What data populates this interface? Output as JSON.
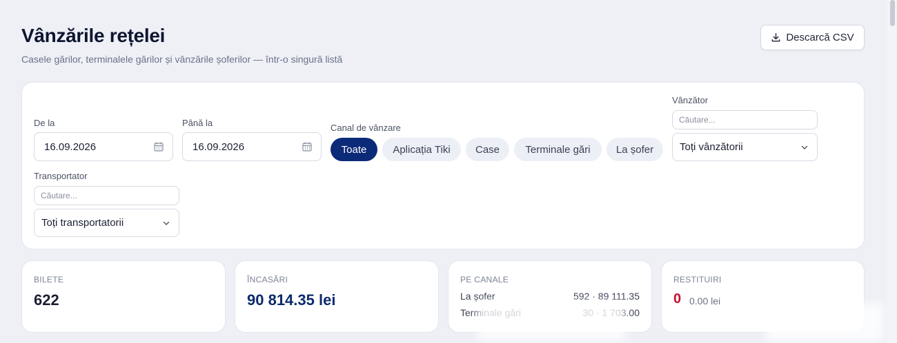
{
  "header": {
    "title": "Vânzările rețelei",
    "subtitle": "Casele gărilor, terminalele gărilor și vânzările șoferilor — într-o singură listă",
    "csv_button": "Descarcă CSV",
    "csv_icon": "download-icon"
  },
  "filters": {
    "date_from": {
      "label": "De la",
      "value": "16.09.2026",
      "icon": "calendar-icon"
    },
    "date_to": {
      "label": "Până la",
      "value": "16.09.2026",
      "icon": "calendar-icon"
    },
    "channel": {
      "label": "Canal de vânzare",
      "options": [
        "Toate",
        "Aplicația Tiki",
        "Case",
        "Terminale gări",
        "La șofer"
      ],
      "selected": "Toate"
    },
    "seller": {
      "label": "Vânzător",
      "search_placeholder": "Căutare...",
      "selected": "Toți vânzătorii",
      "icon": "chevron-down-icon"
    },
    "carrier": {
      "label": "Transportator",
      "search_placeholder": "Căutare...",
      "selected": "Toți transportatorii",
      "icon": "chevron-down-icon"
    }
  },
  "stats": {
    "tickets": {
      "label": "BILETE",
      "value": "622"
    },
    "revenue": {
      "label": "ÎNCASĂRI",
      "value": "90 814.35 lei"
    },
    "channels": {
      "label": "PE CANALE",
      "rows": [
        {
          "name": "La șofer",
          "value": "592 · 89 111.35"
        },
        {
          "name": "Terminale gări",
          "value": "30 · 1 703.00"
        }
      ]
    },
    "refunds": {
      "label": "RESTITUIRI",
      "count": "0",
      "sum": "0.00 lei"
    }
  },
  "colors": {
    "accent": "#0b2a78",
    "refund": "#c8102e",
    "background": "#eef0f6"
  }
}
